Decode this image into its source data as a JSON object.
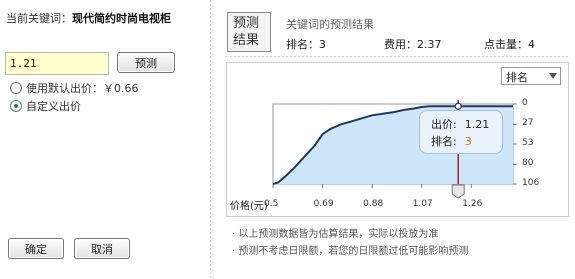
{
  "left": {
    "keyword_label": "当前关键词：",
    "keyword_value": "现代简约时尚电视柜",
    "bid_value": "1.21",
    "predict_button": "预测",
    "radio_default": "使用默认出价：￥0.66",
    "radio_custom": "自定义出价",
    "selected": "custom",
    "ok_button": "确定",
    "cancel_button": "取消"
  },
  "right": {
    "tag": "预测结果",
    "tag_line1": "预测",
    "tag_line2": "结果",
    "title": "关键词的预测结果",
    "rank": "排名：3",
    "cost": "费用：2.37",
    "clicks": "点击量：4",
    "select_value": "排名",
    "tooltip_bid_label": "出价:",
    "tooltip_bid_value": "1.21",
    "tooltip_rank_label": "排名:",
    "tooltip_rank_value": "3",
    "note1": "· 以上预测数据皆为估算结果，实际以投放为准",
    "note2": "· 预测不考虑日限额，若您的日限额过低可能影响预测"
  },
  "chart_data": {
    "type": "area",
    "xlabel": "价格(元)",
    "ylabel": "",
    "x_ticks": [
      "0.5",
      "0.69",
      "0.88",
      "1.07",
      "1.26"
    ],
    "y_ticks": [
      "0",
      "27",
      "53",
      "80",
      "106"
    ],
    "ylim": [
      106,
      0
    ],
    "xlim": [
      0.5,
      1.42
    ],
    "y_inverted": true,
    "grid": false,
    "x": [
      0.5,
      0.52,
      0.55,
      0.58,
      0.62,
      0.66,
      0.69,
      0.72,
      0.76,
      0.8,
      0.85,
      0.88,
      0.92,
      0.96,
      1.0,
      1.04,
      1.07,
      1.1,
      1.15,
      1.21,
      1.26,
      1.32,
      1.38,
      1.42
    ],
    "y": [
      106,
      104,
      95,
      85,
      70,
      55,
      40,
      33,
      27,
      23,
      18,
      15,
      13,
      11,
      8,
      6,
      4,
      3,
      3,
      3,
      3,
      3,
      3,
      3
    ],
    "marker_x": 1.21,
    "colors": {
      "line": "#1f3a5c",
      "fill": "#cde6fa",
      "marker": "#b22222",
      "tooltip_rank": "#e07a12"
    }
  }
}
